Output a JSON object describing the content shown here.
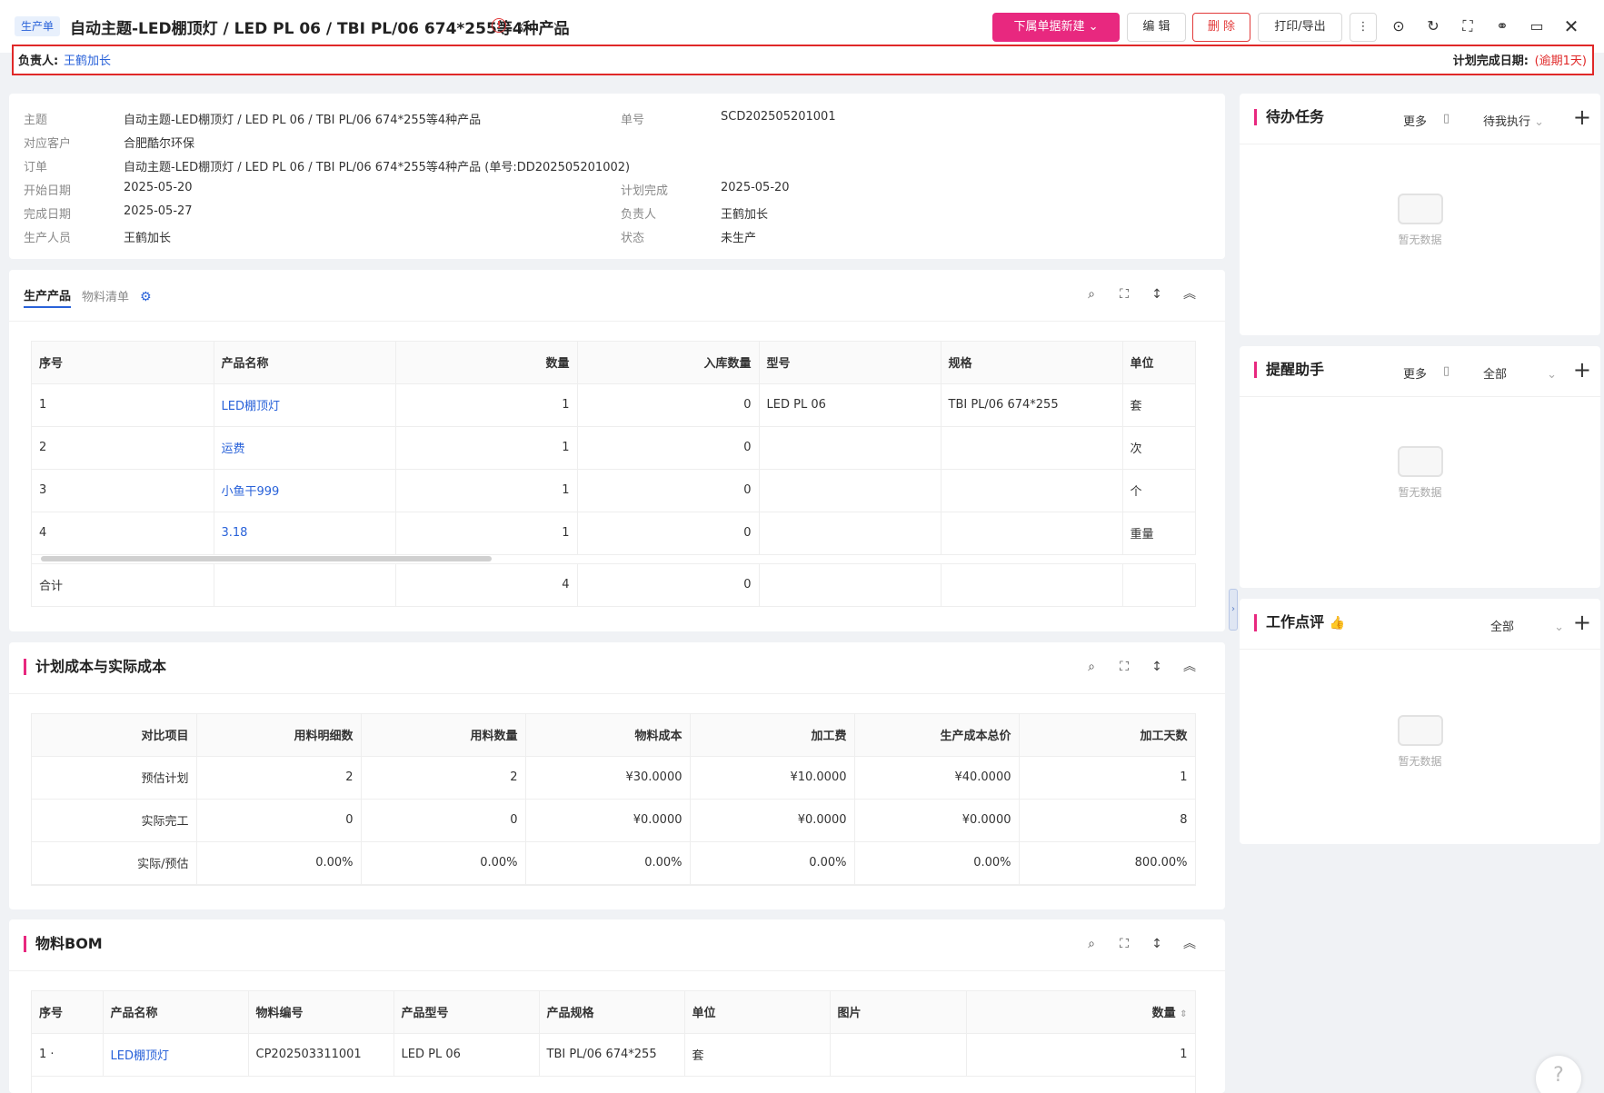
{
  "header": {
    "tag": "生产单",
    "title": "自动主题-LED棚顶灯 / LED PL 06 / TBI PL/06 674*255等4种产品",
    "new_child_label": "下属单据新建",
    "edit_label": "编 辑",
    "delete_label": "删 除",
    "print_label": "打印/导出"
  },
  "owner_bar": {
    "owner_label": "负责人:",
    "owner_name": "王鹤加长",
    "due_label": "计划完成日期:",
    "due_value": "(逾期1天)"
  },
  "info": {
    "subject_label": "主题",
    "subject": "自动主题-LED棚顶灯 / LED PL 06 / TBI PL/06 674*255等4种产品",
    "customer_label": "对应客户",
    "customer": "合肥酷尔环保",
    "order_label": "订单",
    "order": "自动主题-LED棚顶灯 / LED PL 06 / TBI PL/06 674*255等4种产品 (单号:DD202505201002)",
    "start_label": "开始日期",
    "start": "2025-05-20",
    "finish_label": "完成日期",
    "finish": "2025-05-27",
    "staff_label": "生产人员",
    "staff": "王鹤加长",
    "number_label": "单号",
    "number": "SCD202505201001",
    "plan_label": "计划完成",
    "plan": "2025-05-20",
    "owner_label": "负责人",
    "owner": "王鹤加长",
    "status_label": "状态",
    "status": "未生产"
  },
  "products": {
    "tab_active": "生产产品",
    "tab_other": "物料清单",
    "headers": [
      "序号",
      "产品名称",
      "数量",
      "入库数量",
      "型号",
      "规格",
      "单位"
    ],
    "rows": [
      [
        "1",
        "LED棚顶灯",
        "1",
        "0",
        "LED PL 06",
        "TBI PL/06 674*255",
        "套"
      ],
      [
        "2",
        "运费",
        "1",
        "0",
        "",
        "",
        "次"
      ],
      [
        "3",
        "小鱼干999",
        "1",
        "0",
        "",
        "",
        "个"
      ],
      [
        "4",
        "3.18",
        "1",
        "0",
        "",
        "",
        "重量"
      ]
    ],
    "total": [
      "合计",
      "",
      "4",
      "0",
      "",
      "",
      ""
    ]
  },
  "cost": {
    "title": "计划成本与实际成本",
    "headers": [
      "对比项目",
      "用料明细数",
      "用料数量",
      "物料成本",
      "加工费",
      "生产成本总价",
      "加工天数"
    ],
    "rows": [
      [
        "预估计划",
        "2",
        "2",
        "¥30.0000",
        "¥10.0000",
        "¥40.0000",
        "1"
      ],
      [
        "实际完工",
        "0",
        "0",
        "¥0.0000",
        "¥0.0000",
        "¥0.0000",
        "8"
      ],
      [
        "实际/预估",
        "0.00%",
        "0.00%",
        "0.00%",
        "0.00%",
        "0.00%",
        "800.00%"
      ]
    ]
  },
  "bom": {
    "title": "物料BOM",
    "headers": [
      "序号",
      "产品名称",
      "物料编号",
      "产品型号",
      "产品规格",
      "单位",
      "图片",
      "数量"
    ],
    "rows": [
      [
        "1 ·",
        "LED棚顶灯",
        "CP202503311001",
        "LED PL 06",
        "TBI PL/06 674*255",
        "套",
        "",
        "1"
      ]
    ]
  },
  "side": {
    "todo": {
      "title": "待办任务",
      "more": "更多",
      "filter": "待我执行",
      "empty": "暂无数据"
    },
    "remind": {
      "title": "提醒助手",
      "more": "更多",
      "filter": "全部",
      "empty": "暂无数据"
    },
    "review": {
      "title": "工作点评",
      "filter": "全部",
      "empty": "暂无数据"
    }
  },
  "icons": [
    "warning-icon",
    "chevron-left-icon",
    "chevron-right-icon",
    "play-icon",
    "refresh-icon",
    "fullscreen-icon",
    "link-icon",
    "laptop-icon",
    "close-icon",
    "search-icon",
    "expand-icon",
    "sort-icon",
    "collapse-icon",
    "gear-icon",
    "thumbs-up-icon",
    "help-icon"
  ]
}
